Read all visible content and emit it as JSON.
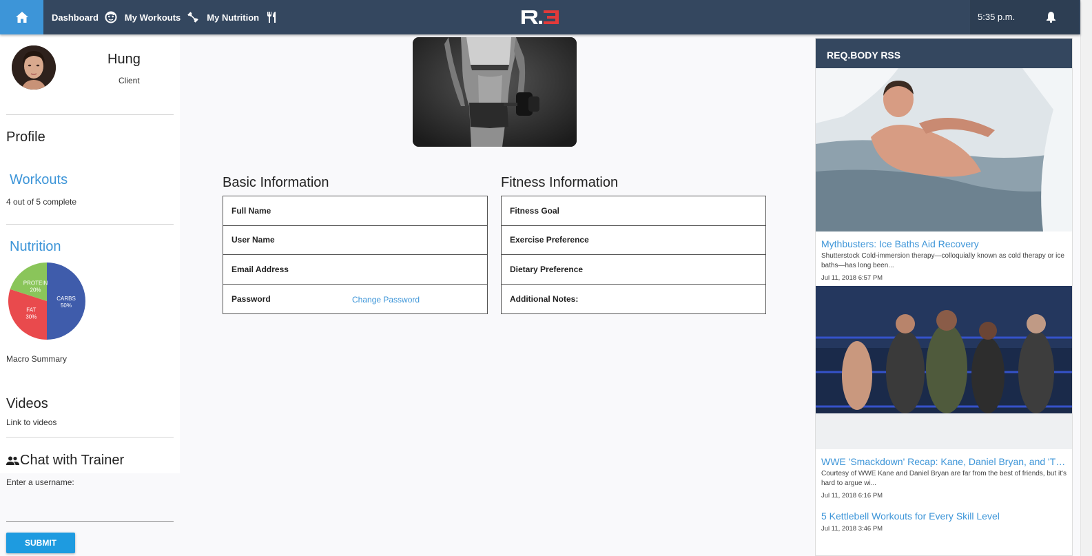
{
  "topbar": {
    "nav": [
      {
        "label": "Dashboard",
        "icon": "face-icon"
      },
      {
        "label": "My Workouts",
        "icon": "dumbbell-icon"
      },
      {
        "label": "My Nutrition",
        "icon": "utensils-icon"
      }
    ],
    "logo_text": "R.3",
    "time": "5:35 p.m."
  },
  "profile": {
    "name": "Hung",
    "role": "Client"
  },
  "sidebar": {
    "profile_title": "Profile",
    "workouts_title": "Workouts",
    "workouts_progress": "4 out of 5 complete",
    "nutrition_title": "Nutrition",
    "macro_summary": "Macro Summary",
    "videos_title": "Videos",
    "videos_link": "Link to videos",
    "chat_title": "Chat with Trainer",
    "chat_label": "Enter a username:",
    "chat_value": "",
    "submit_label": "SUBMIT"
  },
  "chart_data": {
    "type": "pie",
    "labels": [
      "CARBS",
      "FAT",
      "PROTEIN"
    ],
    "values": [
      50,
      30,
      20
    ],
    "colors": [
      "#3f5cab",
      "#e94a4d",
      "#8ac55a"
    ]
  },
  "basic_info": {
    "title": "Basic Information",
    "rows": [
      "Full Name",
      "User Name",
      "Email Address",
      "Password"
    ],
    "change_password": "Change Password"
  },
  "fitness_info": {
    "title": "Fitness Information",
    "rows": [
      "Fitness Goal",
      "Exercise Preference",
      "Dietary Preference",
      "Additional Notes:"
    ]
  },
  "rss": {
    "title": "REQ.BODY RSS",
    "items": [
      {
        "title": "Mythbusters: Ice Baths Aid Recovery",
        "desc": "Shutterstock Cold-immersion therapy—colloquially known as cold therapy or ice baths—has long been...",
        "date": "Jul 11, 2018 6:57 PM"
      },
      {
        "title": "WWE 'Smackdown' Recap: Kane, Daniel Bryan, and 'The ...",
        "desc": "Courtesy of WWE Kane and Daniel Bryan are far from the best of friends, but it's hard to argue wi...",
        "date": "Jul 11, 2018 6:16 PM"
      },
      {
        "title": "5 Kettlebell Workouts for Every Skill Level",
        "desc": "",
        "date": "Jul 11, 2018 3:46 PM"
      }
    ]
  }
}
